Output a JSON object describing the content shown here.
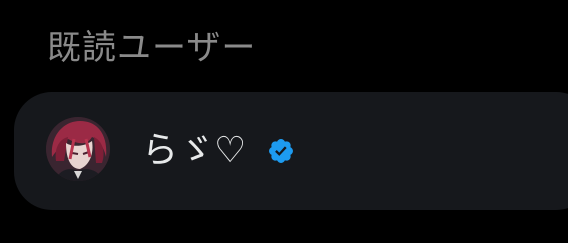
{
  "section": {
    "title": "既読ユーザー"
  },
  "user": {
    "display_name": "らゞ♡",
    "verified": true,
    "avatar_icon": "avatar-image",
    "verified_icon": "verified-badge-icon"
  },
  "colors": {
    "background": "#000000",
    "row_background": "#16181c",
    "title_text": "#8a8a8a",
    "name_text": "#e7e9ea",
    "verified_badge": "#1d9bf0"
  }
}
